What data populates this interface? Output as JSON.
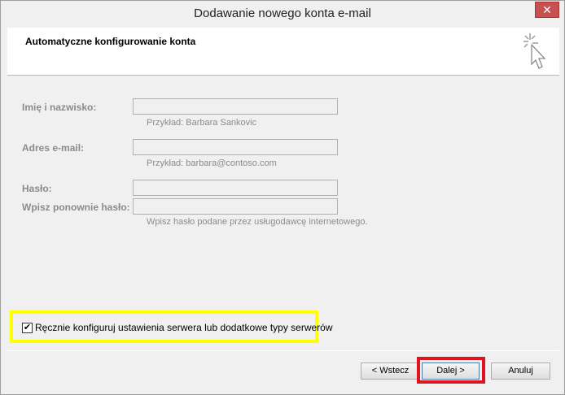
{
  "window": {
    "title": "Dodawanie nowego konta e-mail",
    "close_label": "✕"
  },
  "header": {
    "title": "Automatyczne konfigurowanie konta",
    "icon": "cursor-sparkle-icon"
  },
  "form": {
    "name_label": "Imię i nazwisko:",
    "name_value": "",
    "name_hint": "Przykład: Barbara Sankovic",
    "email_label": "Adres e-mail:",
    "email_value": "",
    "email_hint": "Przykład: barbara@contoso.com",
    "password_label": "Hasło:",
    "password_value": "",
    "password_confirm_label": "Wpisz ponownie hasło:",
    "password_confirm_value": "",
    "password_hint": "Wpisz hasło podane przez usługodawcę internetowego."
  },
  "manual_config": {
    "checked": true,
    "check_mark": "✔",
    "label": "Ręcznie konfiguruj ustawienia serwera lub dodatkowe typy serwerów"
  },
  "buttons": {
    "back": "< Wstecz",
    "next": "Dalej >",
    "cancel": "Anuluj"
  },
  "colors": {
    "highlight_yellow": "#ffff00",
    "highlight_red": "#e0141e",
    "close_button": "#c75050"
  }
}
